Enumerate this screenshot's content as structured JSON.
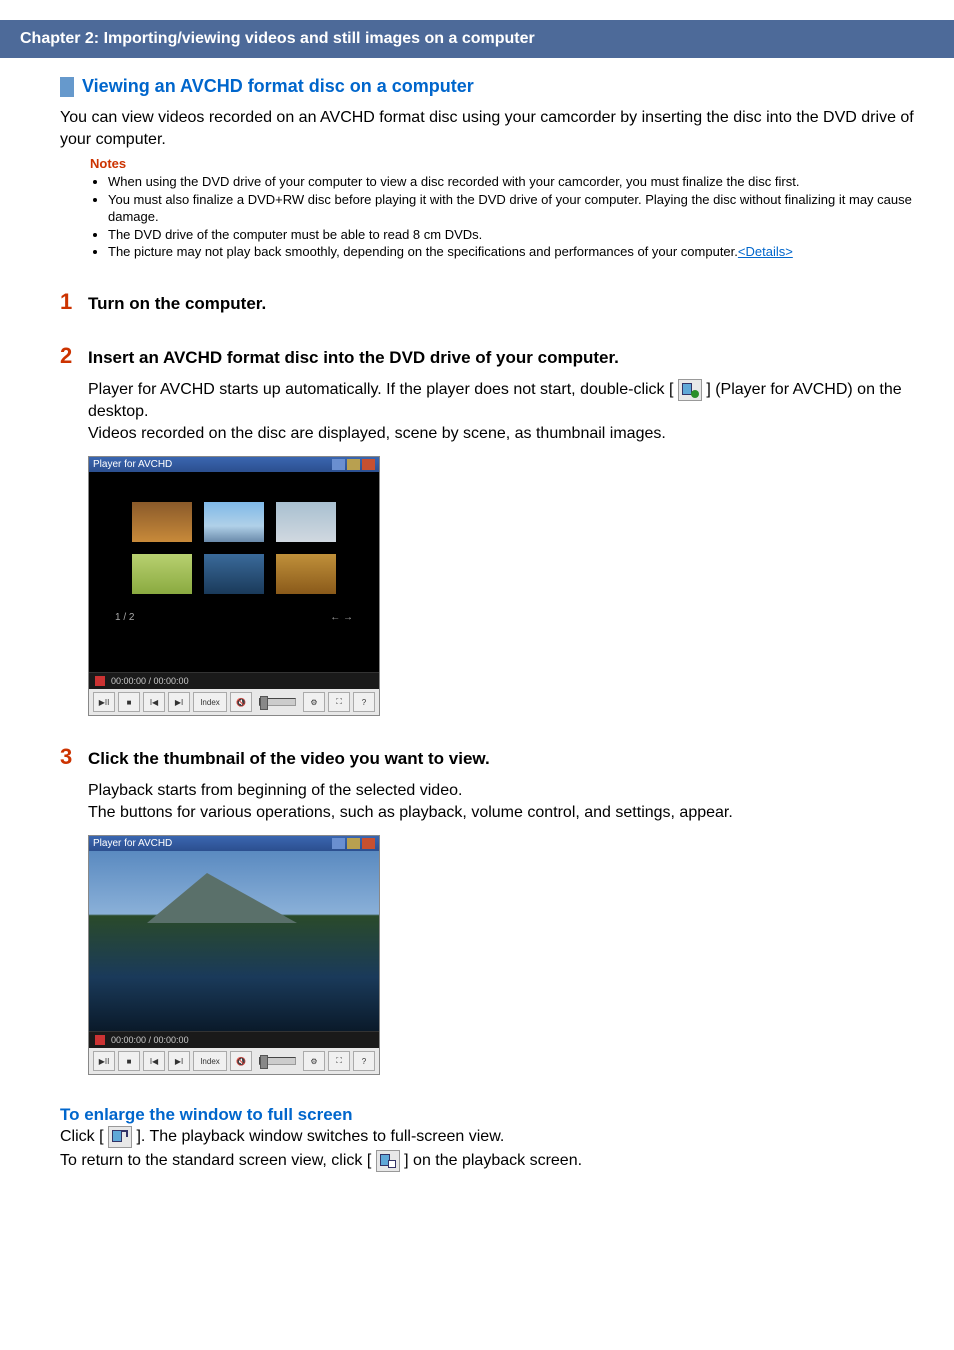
{
  "chapter_bar": "Chapter 2: Importing/viewing videos and still images on a computer",
  "section_title": "Viewing an AVCHD format disc on a computer",
  "intro": "You can view videos recorded on an AVCHD format disc using your camcorder by inserting the disc into the DVD drive of your computer.",
  "notes_label": "Notes",
  "notes": [
    "When using the DVD drive of your computer to view a disc recorded with your camcorder, you must finalize the disc first.",
    "You must also finalize a DVD+RW disc before playing it with the DVD drive of your computer. Playing the disc without finalizing it may cause damage.",
    "The DVD drive of the computer must be able to read 8 cm DVDs.",
    "The picture may not play back smoothly, depending on the specifications and performances of your computer."
  ],
  "details_link": "<Details>",
  "steps": [
    {
      "num": "1",
      "title": "Turn on the computer."
    },
    {
      "num": "2",
      "title": "Insert an AVCHD format disc into the DVD drive of your computer.",
      "body_before_icon": "Player for AVCHD starts up automatically. If the player does not start, double-click [ ",
      "body_after_icon": " ] (Player for AVCHD) on the desktop.",
      "body_line2": "Videos recorded on the disc are displayed, scene by scene, as thumbnail images."
    },
    {
      "num": "3",
      "title": "Click the thumbnail of the video you want to view.",
      "body_line1": "Playback starts from beginning of the selected video.",
      "body_line2": "The buttons for various operations, such as playback, volume control, and settings, appear."
    }
  ],
  "player_window": {
    "title": "Player for AVCHD",
    "page_indicator": "1 / 2",
    "page_arrows": "←  →",
    "time": "00:00:00 / 00:00:00",
    "index_label": "Index"
  },
  "fullscreen": {
    "heading": "To enlarge the window to full screen",
    "line1_before": "Click [ ",
    "line1_after": " ]. The playback window switches to full-screen view.",
    "line2_before": "To return to the standard screen view, click [ ",
    "line2_after": " ] on the playback screen."
  }
}
